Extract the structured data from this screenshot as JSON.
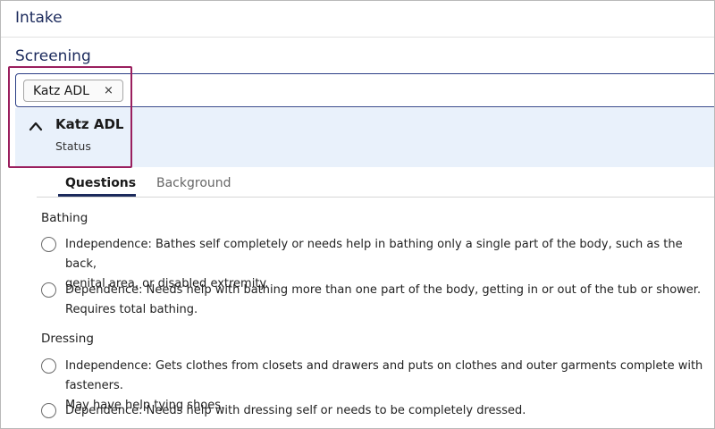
{
  "header": {
    "title": "Intake"
  },
  "section": {
    "title": "Screening"
  },
  "search": {
    "chip_label": "Katz ADL",
    "chip_close": "×"
  },
  "result": {
    "title": "Katz ADL",
    "subtitle": "Status"
  },
  "tabs": [
    {
      "label": "Questions",
      "active": true
    },
    {
      "label": "Background",
      "active": false
    }
  ],
  "groups": [
    {
      "label": "Bathing",
      "options": [
        {
          "line1": "Independence: Bathes self completely or needs help in bathing only a single part of the body, such as the back,",
          "line2": "genital area, or disabled extremity."
        },
        {
          "line1": "Dependence: Needs help with bathing more than one part of the body, getting in or out of the tub or shower.",
          "line2": "Requires total bathing."
        }
      ]
    },
    {
      "label": "Dressing",
      "options": [
        {
          "line1": "Independence: Gets clothes from closets and drawers and puts on clothes and outer garments complete with fasteners.",
          "line2": "May have help tying shoes."
        },
        {
          "line1": "Dependence: Needs help with dressing self or needs to be completely dressed.",
          "line2": ""
        }
      ]
    }
  ],
  "colors": {
    "accent": "#1b2a5c",
    "highlight": "#9a1f5e",
    "panel": "#e9f1fb"
  }
}
